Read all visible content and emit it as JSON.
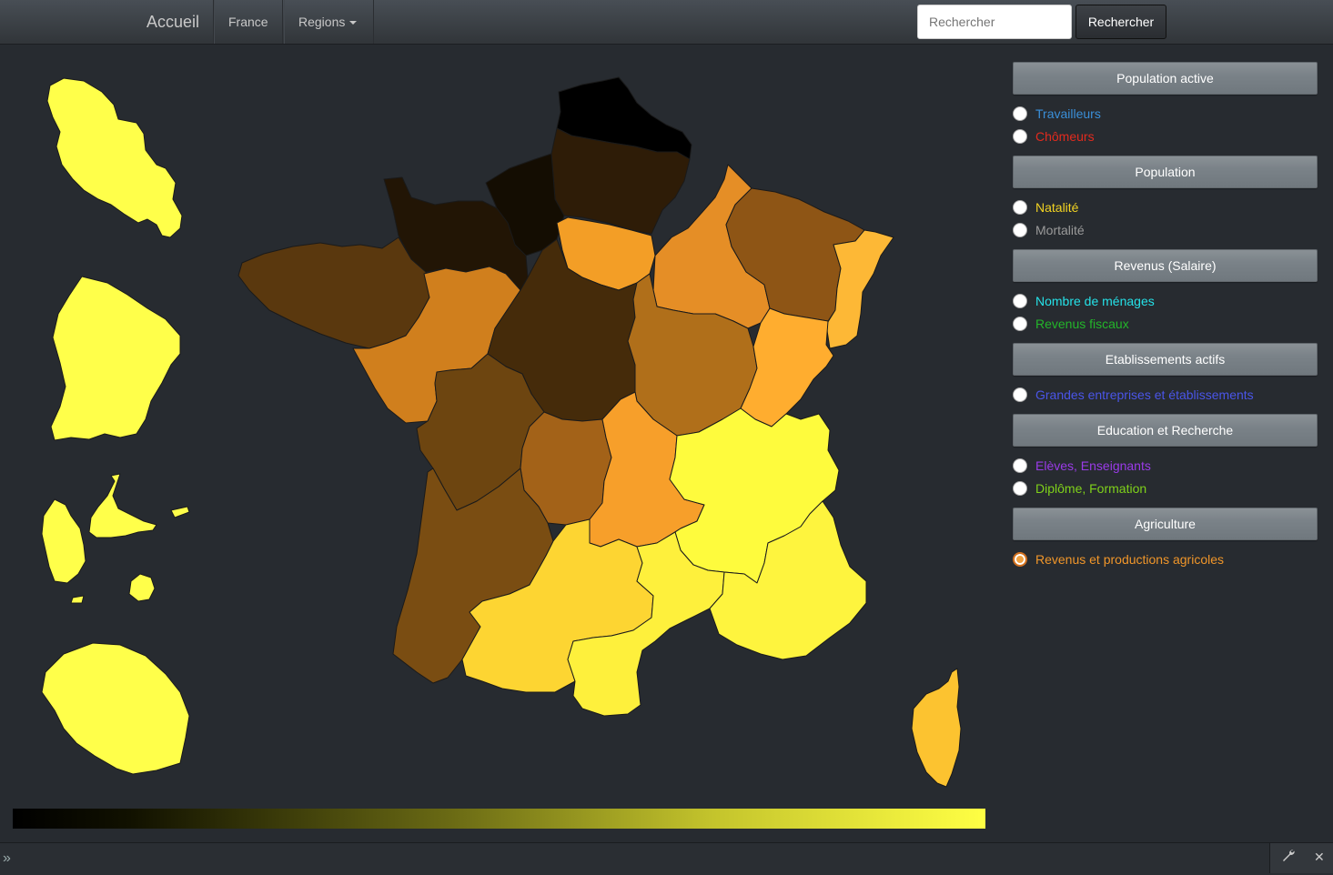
{
  "navbar": {
    "brand": "Accueil",
    "items": [
      {
        "label": "France"
      },
      {
        "label": "Regions"
      }
    ],
    "search_placeholder": "Rechercher",
    "search_button": "Rechercher"
  },
  "map": {
    "legend_gradient": [
      "#000000",
      "#ffff44"
    ],
    "region_colors": {
      "nord": "#000000",
      "picardie": "#2e1c07",
      "haute_normandie": "#140d02",
      "basse_normandie": "#221505",
      "bretagne": "#5a380e",
      "idf": "#f39e26",
      "champagne": "#e58e26",
      "lorraine": "#8e5515",
      "alsace": "#fdb836",
      "pays_loire": "#d07f1d",
      "centre": "#452b0a",
      "bourgogne": "#b06f1a",
      "franche_comte": "#ffad2f",
      "poitou": "#6d4510",
      "limousin": "#a36218",
      "auvergne": "#f79f2a",
      "rhone_alpes": "#fefb3d",
      "aquitaine": "#7a4d12",
      "midi_pyrenees": "#fdd532",
      "languedoc": "#fef03c",
      "paca": "#fef43e",
      "corse": "#fcc330",
      "martinique": "#ffff4a",
      "guyane": "#ffff4a",
      "guadeloupe": "#ffff4a",
      "reunion": "#ffff4a"
    }
  },
  "panel": {
    "sections": [
      {
        "title": "Population active",
        "options": [
          {
            "label": "Travailleurs",
            "color": "#3a8fd9",
            "selected": false
          },
          {
            "label": "Chômeurs",
            "color": "#e22b1e",
            "selected": false
          }
        ]
      },
      {
        "title": "Population",
        "options": [
          {
            "label": "Natalité",
            "color": "#f2d322",
            "selected": false
          },
          {
            "label": "Mortalité",
            "color": "#9a9a9a",
            "selected": false
          }
        ]
      },
      {
        "title": "Revenus (Salaire)",
        "options": [
          {
            "label": "Nombre de ménages",
            "color": "#25e2e8",
            "selected": false
          },
          {
            "label": "Revenus fiscaux",
            "color": "#23b52a",
            "selected": false
          }
        ]
      },
      {
        "title": "Etablissements actifs",
        "options": [
          {
            "label": "Grandes entreprises et établissements",
            "color": "#4a55e8",
            "selected": false
          }
        ]
      },
      {
        "title": "Education et Recherche",
        "options": [
          {
            "label": "Elèves, Enseignants",
            "color": "#9a3be8",
            "selected": false
          },
          {
            "label": "Diplôme, Formation",
            "color": "#7fd11a",
            "selected": false
          }
        ]
      },
      {
        "title": "Agriculture",
        "options": [
          {
            "label": "Revenus et productions agricoles",
            "color": "#f0962a",
            "selected": true
          }
        ]
      }
    ]
  },
  "bottombar": {
    "expand_icon": "double-chevron-right-icon",
    "tool_icon": "wrench-icon",
    "close_icon": "close-icon"
  }
}
